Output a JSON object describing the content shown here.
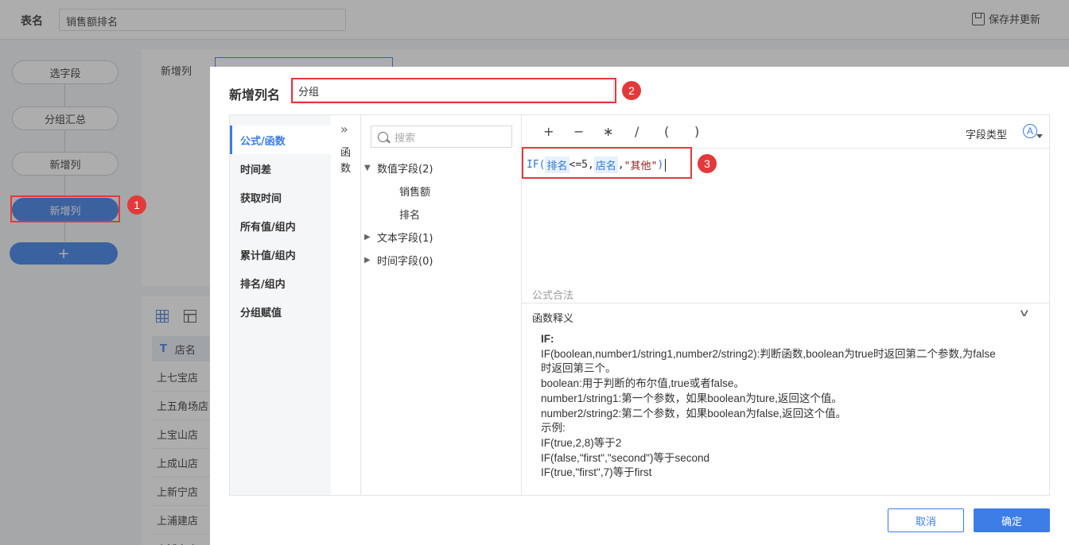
{
  "topbar": {
    "table_name_label": "表名",
    "table_name_value": "销售额排名",
    "save_label": "保存并更新"
  },
  "steps": {
    "items": [
      "选字段",
      "分组汇总",
      "新增列",
      "新增列"
    ],
    "add_label": "+"
  },
  "config": {
    "new_column_label": "新增列"
  },
  "table": {
    "column_type": "T",
    "column_header": "店名",
    "rows": [
      "上七宝店",
      "上五角场店",
      "上宝山店",
      "上成山店",
      "上新宁店",
      "上浦建店",
      "上浦东店"
    ]
  },
  "annotations": [
    "1",
    "2",
    "3"
  ],
  "modal": {
    "title": "新增列名",
    "column_name": "分组",
    "categories": [
      "公式/函数",
      "时间差",
      "获取时间",
      "所有值/组内",
      "累计值/组内",
      "排名/组内",
      "分组赋值"
    ],
    "active_category": "公式/函数",
    "panel_toggle_icon": "»",
    "panel_label": "函数",
    "search_placeholder": "搜索",
    "field_groups": [
      {
        "label": "数值字段(2)",
        "expanded": true,
        "fields": [
          "销售额",
          "排名"
        ]
      },
      {
        "label": "文本字段(1)",
        "expanded": false,
        "fields": []
      },
      {
        "label": "时间字段(0)",
        "expanded": false,
        "fields": []
      }
    ],
    "operators": [
      "+",
      "−",
      "∗",
      "/",
      "(",
      ")"
    ],
    "field_type_label": "字段类型",
    "field_type_icon": "A",
    "formula": {
      "fn": "IF(",
      "tok1": "排名",
      "mid": "<=5,",
      "tok2": "店名",
      "comma": ",",
      "str": "\"其他\"",
      "end": ")"
    },
    "validity": "公式合法",
    "doc_title": "函数释义",
    "doc_lines": [
      "IF:",
      "IF(boolean,number1/string1,number2/string2):判断函数,boolean为true时返回第二个参数,为false",
      "时返回第三个。",
      "boolean:用于判断的布尔值,true或者false。",
      "number1/string1:第一个参数，如果boolean为ture,返回这个值。",
      "number2/string2:第二个参数，如果boolean为false,返回这个值。",
      "示例:",
      "IF(true,2,8)等于2",
      "IF(false,\"first\",\"second\")等于second",
      "IF(true,\"first\",7)等于first"
    ],
    "cancel_label": "取消",
    "ok_label": "确定"
  },
  "colors": {
    "accent": "#3c7de6",
    "annotation": "#e23a3a"
  }
}
